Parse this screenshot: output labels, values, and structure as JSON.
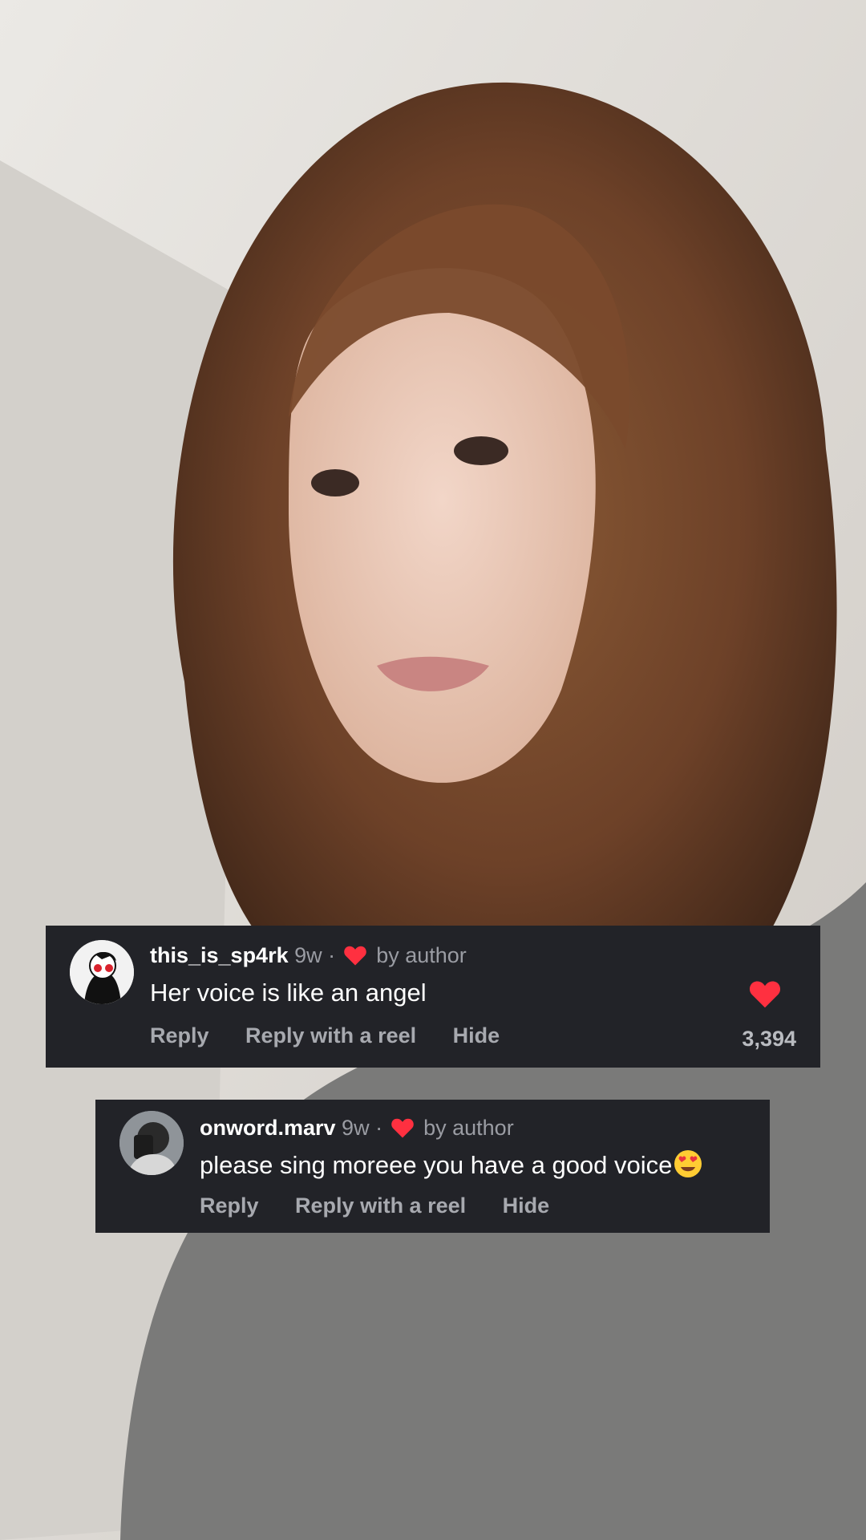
{
  "accent": {
    "heart": "#ff3040",
    "card_bg": "#222328"
  },
  "photo": {
    "subject": ""
  },
  "comments": [
    {
      "username": "this_is_sp4rk",
      "time": "9w",
      "separator": "·",
      "liked_by_label": "by author",
      "text": "Her voice is like an angel",
      "actions": {
        "reply": "Reply",
        "reply_reel": "Reply with a reel",
        "hide": "Hide"
      },
      "like_count": "3,394",
      "avatar_icon": "anime-avatar-icon"
    },
    {
      "username": "onword.marv",
      "time": "9w",
      "separator": "·",
      "liked_by_label": "by author",
      "text": "please sing moreee you have a good voice",
      "emoji": "heart-eyes-emoji",
      "actions": {
        "reply": "Reply",
        "reply_reel": "Reply with a reel",
        "hide": "Hide"
      },
      "avatar_icon": "profile-photo-icon"
    }
  ]
}
